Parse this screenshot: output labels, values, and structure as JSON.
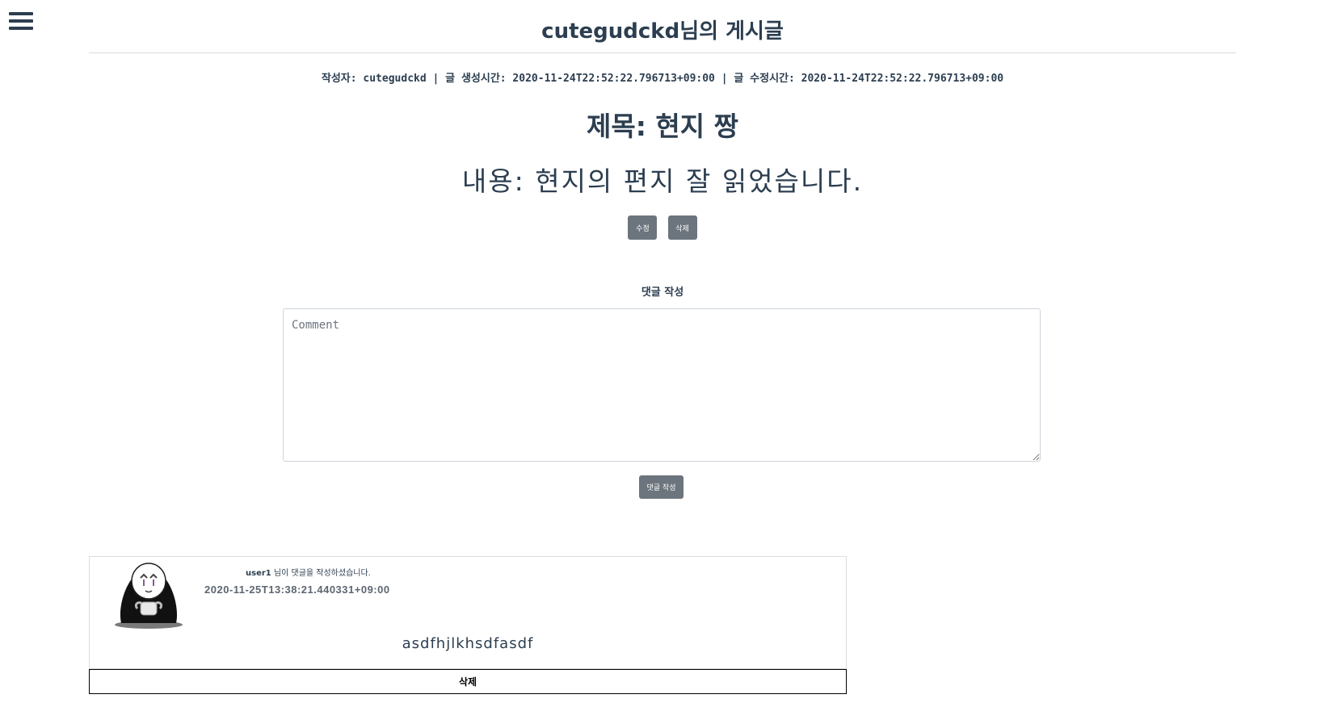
{
  "header": {
    "title": "cutegudckd님의 게시글",
    "menu_icon": "hamburger-menu-icon"
  },
  "post": {
    "meta": "작성자: cutegudckd | 글 생성시간: 2020-11-24T22:52:22.796713+09:00 | 글 수정시간: 2020-11-24T22:52:22.796713+09:00",
    "title": "제목: 현지 짱",
    "content": "내용: 현지의 편지 잘 읽었습니다.",
    "edit_label": "수정",
    "delete_label": "삭제"
  },
  "comment_form": {
    "heading": "댓글 작성",
    "placeholder": "Comment",
    "submit_label": "댓글 작성"
  },
  "comments": [
    {
      "username": "user1",
      "author_suffix": " 님이 댓글을 작성하셨습니다.",
      "created_at": "2020-11-25T13:38:21.440331+09:00",
      "body": "asdfhjlkhsdfasdf",
      "delete_label": "삭제",
      "avatar_icon": "no-face-character-avatar"
    }
  ],
  "colors": {
    "text": "#2c3e50",
    "button_bg": "#6c757d",
    "button_text": "#ffffff"
  }
}
